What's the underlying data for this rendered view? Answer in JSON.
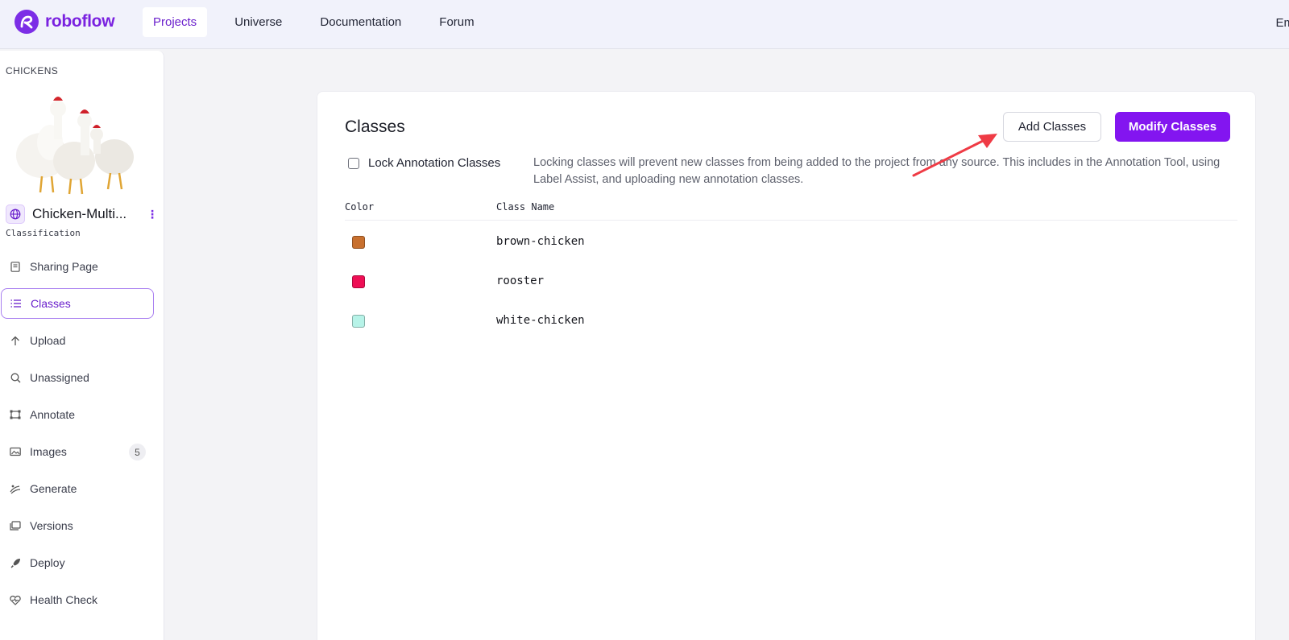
{
  "nav": {
    "brand": "roboflow",
    "items": [
      {
        "label": "Projects",
        "active": true
      },
      {
        "label": "Universe",
        "active": false
      },
      {
        "label": "Documentation",
        "active": false
      },
      {
        "label": "Forum",
        "active": false
      }
    ],
    "user_partial": "Em"
  },
  "sidebar": {
    "workspace": "CHICKENS",
    "project_name": "Chicken-Multi...",
    "project_type": "Classification",
    "items": [
      {
        "label": "Sharing Page",
        "icon": "document-icon"
      },
      {
        "label": "Classes",
        "icon": "list-icon",
        "active": true
      },
      {
        "label": "Upload",
        "icon": "arrow-up-icon"
      },
      {
        "label": "Unassigned",
        "icon": "search-icon"
      },
      {
        "label": "Annotate",
        "icon": "annotate-icon"
      },
      {
        "label": "Images",
        "icon": "images-icon",
        "badge": "5"
      },
      {
        "label": "Generate",
        "icon": "generate-icon"
      },
      {
        "label": "Versions",
        "icon": "versions-icon"
      },
      {
        "label": "Deploy",
        "icon": "rocket-icon"
      },
      {
        "label": "Health Check",
        "icon": "heart-pulse-icon"
      }
    ]
  },
  "main": {
    "title": "Classes",
    "add_button": "Add Classes",
    "modify_button": "Modify Classes",
    "lock_label": "Lock Annotation Classes",
    "lock_checked": false,
    "lock_description": "Locking classes will prevent new classes from being added to the project from any source. This includes in the Annotation Tool, using Label Assist, and uploading new annotation classes.",
    "table": {
      "headers": {
        "color": "Color",
        "name": "Class Name"
      },
      "rows": [
        {
          "color": "#c8702f",
          "name": "brown-chicken"
        },
        {
          "color": "#ee0f55",
          "name": "rooster"
        },
        {
          "color": "#b7f3e8",
          "name": "white-chicken"
        }
      ]
    }
  },
  "colors": {
    "accent": "#8315f0",
    "brand": "#7a22e0",
    "annotation_arrow": "#ef3b45"
  }
}
